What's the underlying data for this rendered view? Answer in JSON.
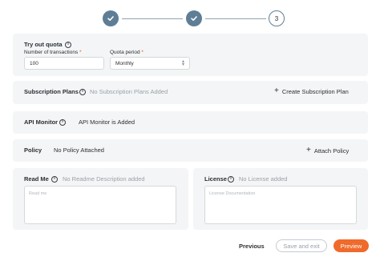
{
  "stepper": {
    "steps": [
      {
        "state": "done",
        "icon": "check-icon"
      },
      {
        "state": "done",
        "icon": "check-icon"
      },
      {
        "state": "current",
        "number": "3"
      }
    ]
  },
  "quota": {
    "title": "Try out quota",
    "transactions_label": "Number of transactions",
    "transactions_value": "100",
    "period_label": "Quota period",
    "period_value": "Monthly"
  },
  "subscription": {
    "title": "Subscription Plans",
    "status": "No Subscription Plans Added",
    "action": "Create Subscription Plan"
  },
  "api_monitor": {
    "title": "API Monitor",
    "status": "API Monitor is Added"
  },
  "policy": {
    "title": "Policy",
    "status": "No Policy Attached",
    "action": "Attach Policy"
  },
  "readme": {
    "title": "Read Me",
    "status": "No Readme Description added",
    "placeholder": "Read me"
  },
  "license": {
    "title": "License",
    "status": "No License added",
    "placeholder": "License Documentation"
  },
  "footer": {
    "previous": "Previous",
    "save": "Save and exit",
    "preview": "Preview"
  },
  "colors": {
    "step_done": "#5f7e95",
    "primary": "#f06a2b",
    "required": "#e4572e"
  }
}
